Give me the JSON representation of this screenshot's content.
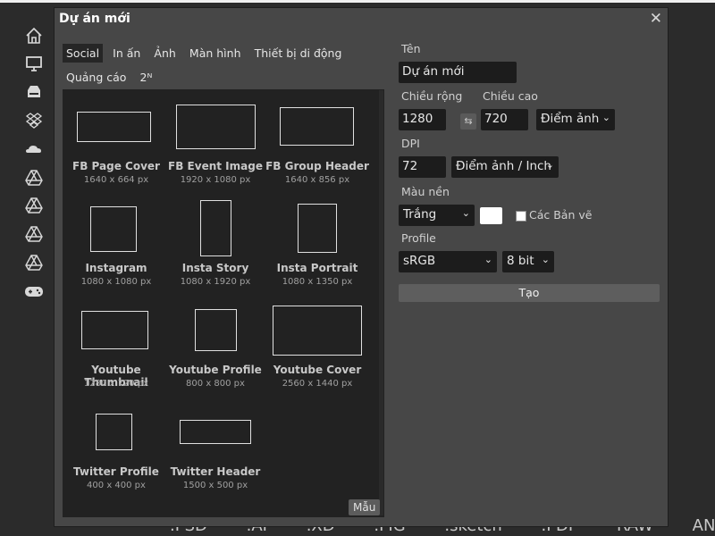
{
  "dialog": {
    "title": "Dự án mới",
    "close_icon": "close-icon"
  },
  "tabs": [
    {
      "label": "Social",
      "active": true
    },
    {
      "label": "In ấn",
      "active": false
    },
    {
      "label": "Ảnh",
      "active": false
    },
    {
      "label": "Màn hình",
      "active": false
    },
    {
      "label": "Thiết bị di động",
      "active": false
    },
    {
      "label": "Quảng cáo",
      "active": false
    },
    {
      "label": "2ᴺ",
      "active": false
    }
  ],
  "presets": [
    {
      "name": "FB Page Cover",
      "size": "1640 x 664 px"
    },
    {
      "name": "FB Event Image",
      "size": "1920 x 1080 px"
    },
    {
      "name": "FB Group Header",
      "size": "1640 x 856 px"
    },
    {
      "name": "Instagram",
      "size": "1080 x 1080 px"
    },
    {
      "name": "Insta Story",
      "size": "1080 x 1920 px"
    },
    {
      "name": "Insta Portrait",
      "size": "1080 x 1350 px"
    },
    {
      "name": "Youtube Thumbnail",
      "size": "1280 x 720 px"
    },
    {
      "name": "Youtube Profile",
      "size": "800 x 800 px"
    },
    {
      "name": "Youtube Cover",
      "size": "2560 x 1440 px"
    },
    {
      "name": "Twitter Profile",
      "size": "400 x 400 px"
    },
    {
      "name": "Twitter Header",
      "size": "1500 x 500 px"
    }
  ],
  "template_button": "Mẫu",
  "form": {
    "name_label": "Tên",
    "name_value": "Dự án mới",
    "width_label": "Chiều rộng",
    "width_value": "1280",
    "height_label": "Chiều cao",
    "height_value": "720",
    "unit_value": "Điểm ảnh",
    "dpi_label": "DPI",
    "dpi_value": "72",
    "dpi_unit_value": "Điểm ảnh / Inch",
    "background_label": "Màu nền",
    "background_value": "Trắng",
    "background_color": "#ffffff",
    "artboards_label": "Các Bản vẽ",
    "profile_label": "Profile",
    "profile_value": "sRGB",
    "bitdepth_value": "8 bit",
    "create_button": "Tạo"
  },
  "sidebar_icons": [
    "home-icon",
    "monitor-icon",
    "drive-icon",
    "dropbox-icon",
    "onedrive-icon",
    "google-drive-icon",
    "google-drive-icon",
    "google-drive-icon",
    "google-drive-icon",
    "gamepad-icon"
  ],
  "formats": [
    ".PSD",
    ".AI",
    ".XD",
    ".FIG",
    ".sketch",
    ".PDF",
    "RAW",
    "ANY"
  ]
}
